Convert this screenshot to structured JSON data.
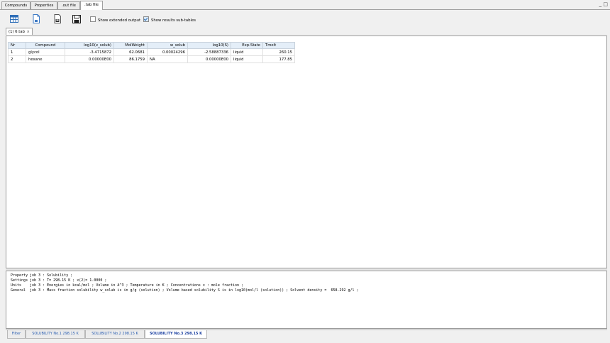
{
  "top_tabs": [
    {
      "label": "Compounds"
    },
    {
      "label": "Properties"
    },
    {
      "label": ".out file"
    },
    {
      "label": ".tab file"
    }
  ],
  "window_controls": "_ □",
  "toolbar": {
    "extended_output_label": "Show extended output",
    "extended_output_checked": false,
    "subtables_label": "Show results sub-tables",
    "subtables_checked": true
  },
  "doc_tab": {
    "label": "(1) 6.tab",
    "close": "×"
  },
  "table": {
    "headers": [
      "Nr",
      "Compound",
      "log10(x_solub)",
      "MolWeight",
      "w_solub",
      "log10(S)",
      "Exp-State",
      "Tmelt"
    ],
    "rows": [
      [
        "1",
        "glycol",
        "-3.4715872",
        "62.0681",
        "0.00024296",
        "-2.58887336",
        "liquid",
        "260.15"
      ],
      [
        "2",
        "hexane",
        "0.00000E00",
        "86.1759",
        "NA",
        "0.00000E00",
        "liquid",
        "177.85"
      ]
    ]
  },
  "info": [
    {
      "key": "Property",
      "text": "job 3 : Solubility ;"
    },
    {
      "key": "Settings",
      "text": "job 3 : T= 298.15 K ; x(2)= 1.0000 ;"
    },
    {
      "key": "Units",
      "text": "job 3 : Energies in kcal/mol ; Volume in A^3 ; Temperature in K ; Concentrations x : mole fraction ;"
    },
    {
      "key": "General",
      "text": "job 3 : Mass fraction solubility w_solub is in g/g (solution) ; Volume based solubility S is in log10(mol/l (solution)) ; Solvent density =  658.292 g/l ;"
    }
  ],
  "bottom_tabs": [
    {
      "label": "Filter"
    },
    {
      "label": "SOLUBILITY No.1 298.15 K"
    },
    {
      "label": "SOLUBILITY No.2 298.15 K"
    },
    {
      "label": "SOLUBILITY No.3 298.15 K"
    }
  ]
}
